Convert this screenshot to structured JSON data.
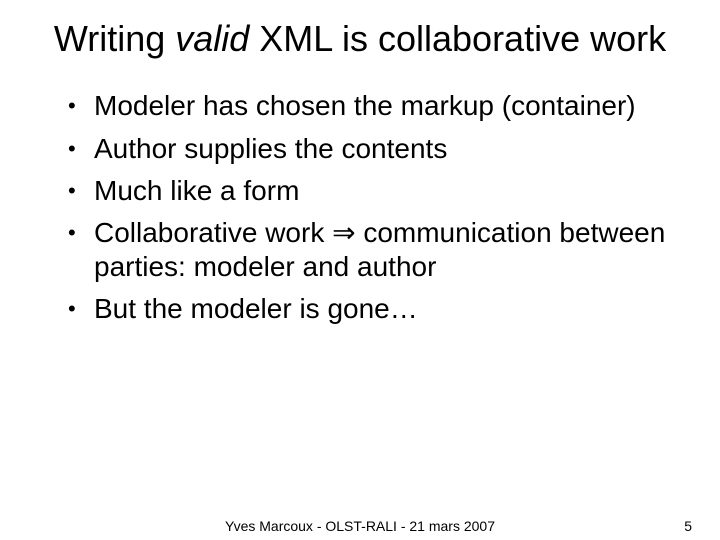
{
  "title": {
    "pre": "Writing ",
    "em": "valid",
    "post": " XML is collaborative work"
  },
  "bullets": [
    "Modeler has chosen the markup (container)",
    "Author supplies the contents",
    "Much like a form",
    "Collaborative work ⇒ communication between parties: modeler and author",
    "But the modeler is gone…"
  ],
  "footer": {
    "center": "Yves Marcoux - OLST-RALI - 21 mars 2007",
    "page": "5"
  }
}
